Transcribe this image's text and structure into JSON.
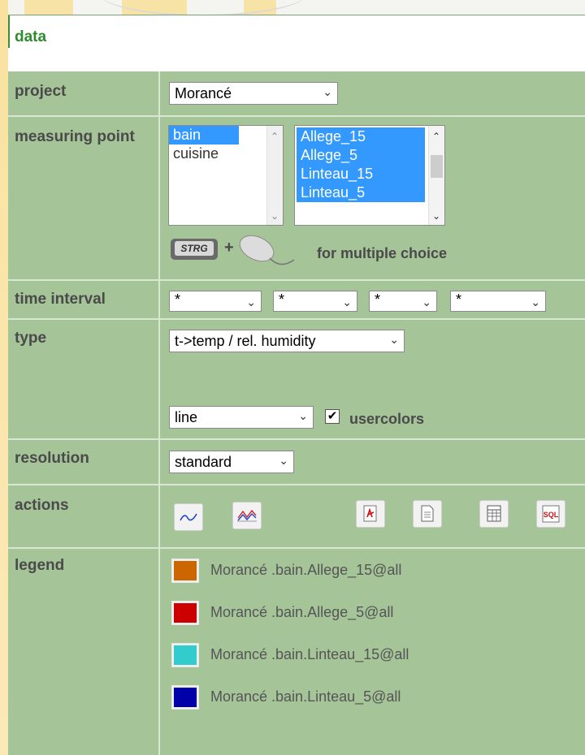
{
  "header": {
    "title": "data"
  },
  "rows": {
    "project": {
      "label": "project",
      "value": "Morancé"
    },
    "measuring_point": {
      "label": "measuring point",
      "list1": [
        "bain",
        "cuisine"
      ],
      "list2": [
        "Allege_15",
        "Allege_5",
        "Linteau_15",
        "Linteau_5"
      ],
      "hint": "for multiple choice",
      "key_label": "STRG",
      "plus": "+"
    },
    "time_interval": {
      "label": "time interval",
      "values": [
        "*",
        "*",
        "*",
        "*"
      ]
    },
    "type": {
      "label": "type",
      "value": "t->temp / rel. humidity",
      "chart_value": "line",
      "usercolors_label": "usercolors",
      "usercolors_checked": true
    },
    "resolution": {
      "label": "resolution",
      "value": "standard"
    },
    "actions": {
      "label": "actions"
    },
    "legend": {
      "label": "legend",
      "items": [
        {
          "text": "Morancé .bain.Allege_15@all",
          "color": "#cc6600"
        },
        {
          "text": "Morancé .bain.Allege_5@all",
          "color": "#cc0000"
        },
        {
          "text": "Morancé .bain.Linteau_15@all",
          "color": "#33cccc"
        },
        {
          "text": "Morancé .bain.Linteau_5@all",
          "color": "#0000aa"
        }
      ]
    }
  },
  "icons": {
    "arrow": "chevron-down-icon",
    "actions": [
      "line-chart-icon",
      "multi-line-chart-icon",
      "pdf-icon",
      "document-icon",
      "table-icon",
      "sql-icon"
    ]
  }
}
